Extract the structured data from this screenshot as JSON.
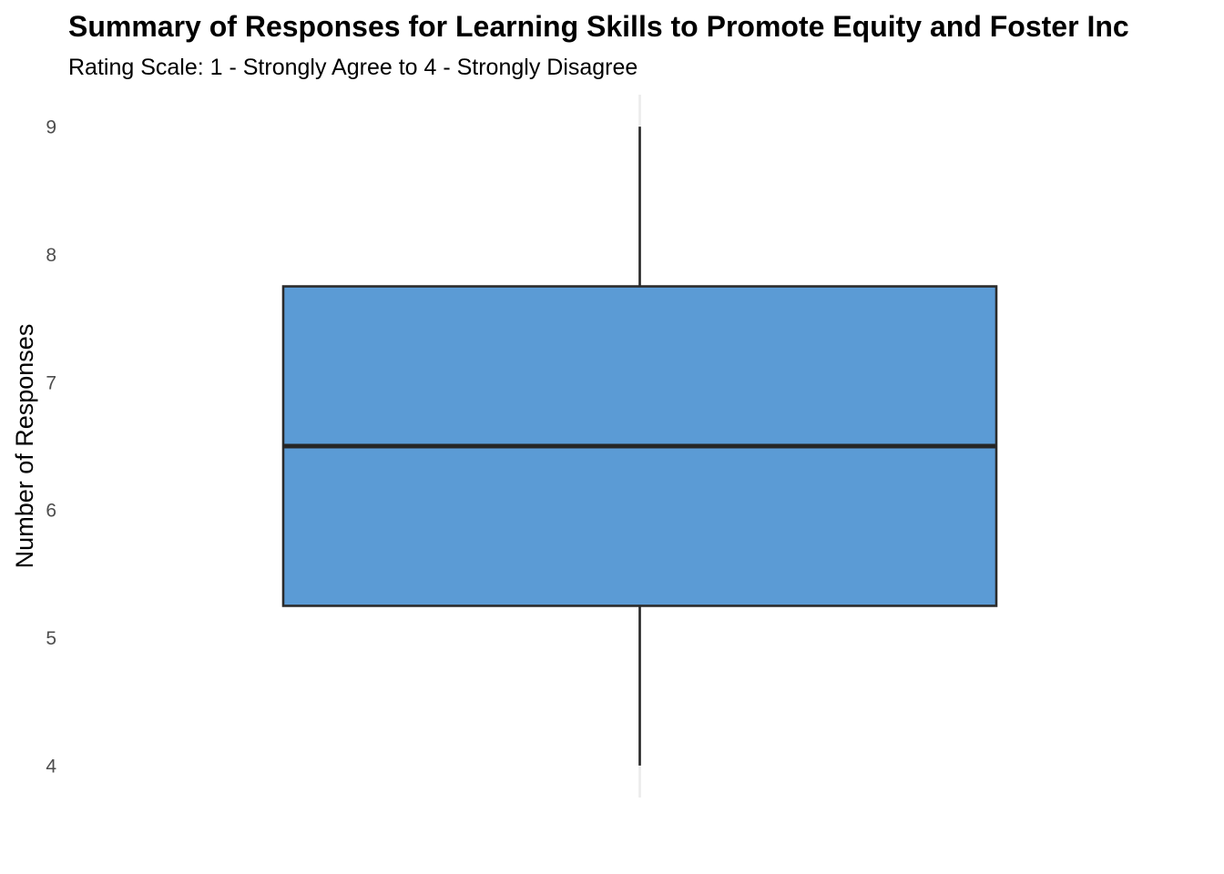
{
  "chart_data": {
    "type": "boxplot",
    "title": "Summary of Responses for Learning Skills to Promote Equity and Foster Inc",
    "subtitle": "Rating Scale: 1 - Strongly Agree to 4 - Strongly Disagree",
    "xlabel": "",
    "ylabel": "Number of Responses",
    "yticks": [
      4,
      5,
      6,
      7,
      8,
      9
    ],
    "ylim": [
      3.75,
      9.25
    ],
    "grid": {
      "x_major": true,
      "y_major": false
    },
    "legend": "none",
    "box": {
      "min": 4,
      "q1": 5.25,
      "median": 6.5,
      "q3": 7.75,
      "max": 9
    },
    "colors": {
      "box_fill": "#5b9bd5",
      "box_stroke": "#2b2b2b",
      "median": "#262626",
      "whisker": "#262626",
      "grid": "#ebebeb"
    }
  }
}
